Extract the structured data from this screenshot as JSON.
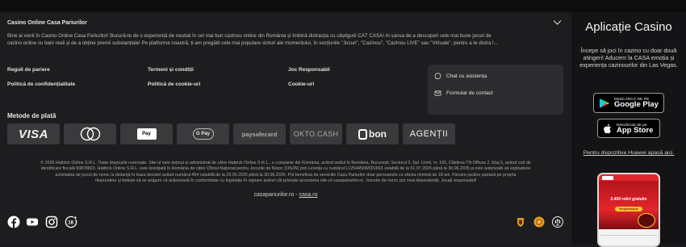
{
  "footer": {
    "accordion_title": "Casino Online Casa Pariurilor",
    "intro_lines": [
      "Bine ai venit în Casino Online Casa Pariurilor! Bucură-te de o experiență de neuitat în cel mai bun cazinou online din România și îmbină distracția cu câștigurii CÂT CASA! Ai șansa de a descoperi cele mai bune jocuri de",
      "cazino online cu bani reali și de a obține premii substanțiale! Pe platforma noastră, ți-am pregătit cele mai populare sloturi ale momentului, în secțiunile \"Jocuri\", \"Cazinou\", \"Cazinou LIVE\" sau \"Virtuale\", pentru a te distra l..."
    ],
    "links": {
      "betting_rules": "Reguli de pariere",
      "privacy_policy": "Politică de confidențialitate",
      "terms": "Termeni și condiții",
      "cookie_policy": "Politică de cookie-uri",
      "responsible_gaming": "Joc Responsabil",
      "cookies": "Cookie-uri"
    },
    "support": {
      "chat": "Chat cu asistența",
      "contact_form": "Formular de contact"
    },
    "payment_title": "Metode de plată",
    "payment_methods": [
      "VISA",
      "Mastercard",
      "Apple Pay",
      "G Pay",
      "paysafecard",
      "OKTO.CASH",
      "bon",
      "AGENȚII"
    ],
    "legal_lines": [
      "© 2026 Hattrick Online S.R.L. Toate drepturile rezervate. Site-ul este deținut și administrat de către Hattrick Online S.R.L., o companie din România, având sediul în România, București, Sectorul 3, Spl. Unirii, nr. 165, Clădirea TN Offices 2, Etaj 5, având cod de",
      "identificare fiscală 50878823. Hattrick Online S.R.L. este licențiată în România de către Oficiul Național pentru Jocurile de Noroc (ONJN) prin Licența cu numărul L1254450W001663 valabilă de la 01.07.2025 până la 30.06.2035 și este autorizată să exploateze",
      "activitatea de jocuri de noroc la distanță în baza deciziei având numărul 454 valabilă de la 29.05.2025 până la 30.06.2026. Pot beneficia de serviciile Casa Pariurilor doar persoanele cu vârsta minimă de 18 ani. Fiecare jucător pariază pe propria",
      "răspundere și trebuie să se asigure că acționează în conformitate cu legislația în vigoare având cât privește accesarea site-ul casapariurilor.ro. Jocurile de noroc pot crea dependență. Jucați responsabil!"
    ],
    "domain_plain": "casapariurilor.ro",
    "domain_separator": " - ",
    "domain_link": "casa.ro",
    "social_icons": [
      "facebook-icon",
      "youtube-icon",
      "instagram-icon",
      "age-18-plus-icon"
    ],
    "regulator_icons": [
      "onjn-crest-icon",
      "anpc-badge-icon",
      "scale-badge-icon"
    ]
  },
  "sidebar": {
    "title": "Aplicație Casino",
    "description": "Începe să joci în cazino cu doar două atingeri! Aducem la CASA emoția și experiența cazinourilor din Las Vegas.",
    "google_play": {
      "small": "DESCARCĂ DE PE",
      "big": "Google Play"
    },
    "app_store": {
      "small": "Descărcați de pe",
      "big": "App Store"
    },
    "huawei_link": "Pentru dispozitive Huawei apasă aici.",
    "phone": {
      "promo": "2.400 rotiri gratuite",
      "cta": "Înregistrează-te"
    }
  },
  "colors": {
    "page_bg": "#1d1d1f",
    "sidebar_bg": "#141416",
    "tile_bg": "#3a3a3d",
    "brand_red": "#e3262c"
  }
}
